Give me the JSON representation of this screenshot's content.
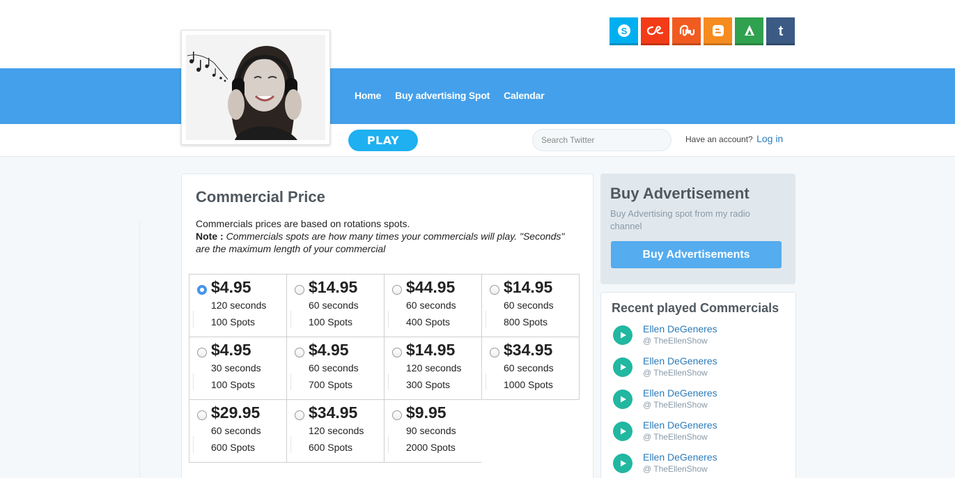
{
  "header": {
    "social_icons": [
      {
        "name": "skype-icon",
        "color": "#00aff0"
      },
      {
        "name": "lastfm-icon",
        "color": "#f33c17"
      },
      {
        "name": "stumbleupon-icon",
        "color": "#f15b1f"
      },
      {
        "name": "blogger-icon",
        "color": "#f68c1f"
      },
      {
        "name": "drive-icon",
        "color": "#30a14e"
      },
      {
        "name": "tumblr-icon",
        "color": "#3b5b85"
      }
    ]
  },
  "nav": {
    "items": [
      {
        "label": "Home"
      },
      {
        "label": "Buy advertising Spot"
      },
      {
        "label": "Calendar"
      }
    ]
  },
  "subbar": {
    "play_label": "PLAY",
    "search_placeholder": "Search Twitter",
    "account_text": "Have an account?",
    "login_label": "Log in"
  },
  "commercial_price": {
    "title": "Commercial Price",
    "description": "Commercials prices are based on rotations spots.",
    "note_label": "Note :",
    "note_text": "Commercials spots are how many times your commercials will play. \"Seconds\" are the maximum length of your commercial",
    "options": [
      {
        "price": "$4.95",
        "seconds": "120 seconds",
        "spots": "100 Spots",
        "selected": true
      },
      {
        "price": "$14.95",
        "seconds": "60 seconds",
        "spots": "100 Spots",
        "selected": false
      },
      {
        "price": "$44.95",
        "seconds": "60 seconds",
        "spots": "400 Spots",
        "selected": false
      },
      {
        "price": "$14.95",
        "seconds": "60 seconds",
        "spots": "800 Spots",
        "selected": false
      },
      {
        "price": "$4.95",
        "seconds": "30 seconds",
        "spots": "100 Spots",
        "selected": false
      },
      {
        "price": "$4.95",
        "seconds": "60 seconds",
        "spots": "700 Spots",
        "selected": false
      },
      {
        "price": "$14.95",
        "seconds": "120 seconds",
        "spots": "300 Spots",
        "selected": false
      },
      {
        "price": "$34.95",
        "seconds": "60 seconds",
        "spots": "1000 Spots",
        "selected": false
      },
      {
        "price": "$29.95",
        "seconds": "60 seconds",
        "spots": "600 Spots",
        "selected": false
      },
      {
        "price": "$34.95",
        "seconds": "120 seconds",
        "spots": "600 Spots",
        "selected": false
      },
      {
        "price": "$9.95",
        "seconds": "90 seconds",
        "spots": "2000 Spots",
        "selected": false
      }
    ]
  },
  "buy_advertisement": {
    "title": "Buy Advertisement",
    "subtitle": "Buy Advertising spot from my radio channel",
    "button_label": "Buy Advertisements"
  },
  "recent": {
    "title": "Recent played Commercials",
    "items": [
      {
        "name": "Ellen DeGeneres",
        "handle": "@ TheEllenShow"
      },
      {
        "name": "Ellen DeGeneres",
        "handle": "@ TheEllenShow"
      },
      {
        "name": "Ellen DeGeneres",
        "handle": "@ TheEllenShow"
      },
      {
        "name": "Ellen DeGeneres",
        "handle": "@ TheEllenShow"
      },
      {
        "name": "Ellen DeGeneres",
        "handle": "@ TheEllenShow"
      }
    ]
  },
  "colors": {
    "nav_bar": "#44a0ea",
    "play_button": "#1eb0f0",
    "buy_button": "#55acee",
    "play_icon": "#22b7a0",
    "link": "#2b7bb9"
  }
}
